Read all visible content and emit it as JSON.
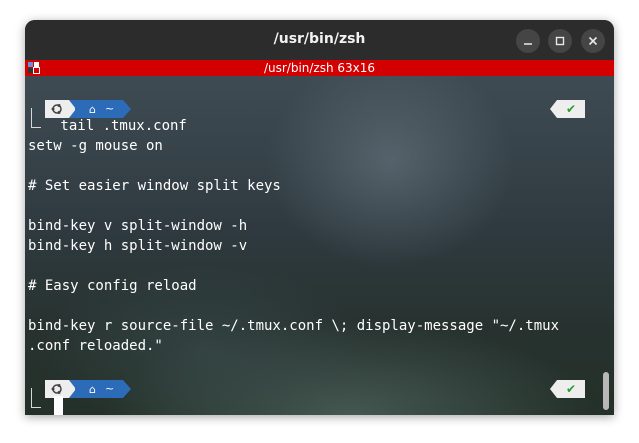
{
  "window": {
    "title": "/usr/bin/zsh",
    "minimize_glyph": "—",
    "maximize_glyph": "□",
    "close_glyph": "✕"
  },
  "tmux": {
    "status_title": "/usr/bin/zsh 63x16",
    "status_color": "#d20000"
  },
  "prompt": {
    "os_icon": "ubuntu-icon",
    "home_icon": "home-icon",
    "dir": "~",
    "status_ok": "✔",
    "accent": "#2b6bb8",
    "ok_color": "#2e9a2e"
  },
  "terminal": {
    "command": " tail .tmux.conf",
    "lines": [
      "setw -g mouse on",
      "",
      "# Set easier window split keys",
      "",
      "bind-key v split-window -h",
      "bind-key h split-window -v",
      "",
      "# Easy config reload",
      "",
      "bind-key r source-file ~/.tmux.conf \\; display-message \"~/.tmux",
      ".conf reloaded.\""
    ]
  }
}
